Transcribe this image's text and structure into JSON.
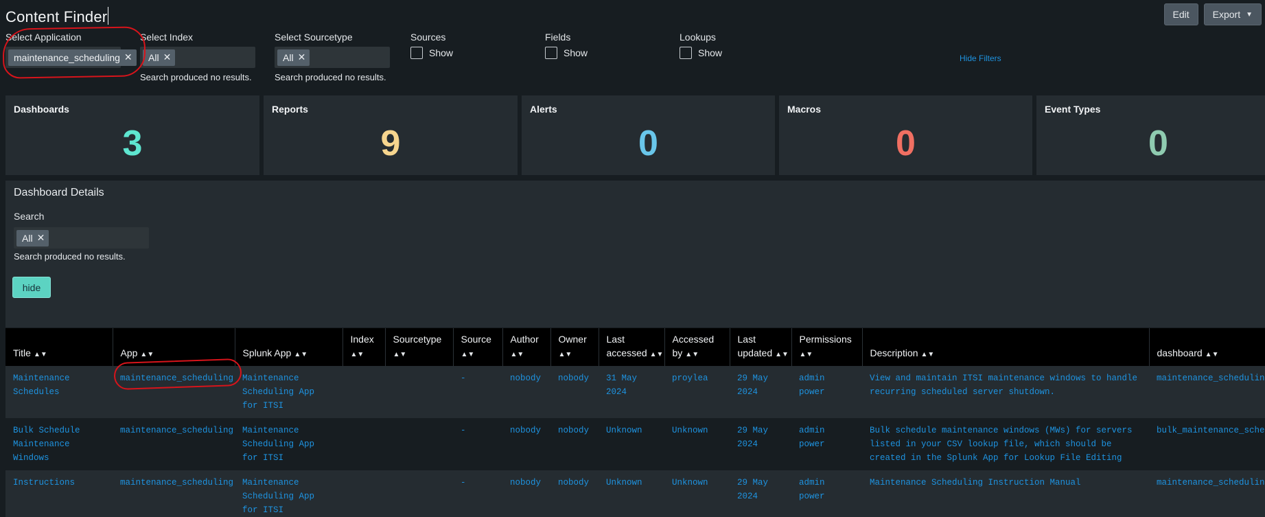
{
  "header": {
    "title": "Content Finder",
    "edit_label": "Edit",
    "export_label": "Export"
  },
  "filters": {
    "application": {
      "label": "Select Application",
      "value": "maintenance_scheduling"
    },
    "index": {
      "label": "Select Index",
      "value": "All",
      "message": "Search produced no results."
    },
    "sourcetype": {
      "label": "Select Sourcetype",
      "value": "All",
      "message": "Search produced no results."
    },
    "sources": {
      "label": "Sources",
      "option": "Show"
    },
    "fields": {
      "label": "Fields",
      "option": "Show"
    },
    "lookups": {
      "label": "Lookups",
      "option": "Show"
    },
    "hide_filters_label": "Hide Filters"
  },
  "cards": [
    {
      "title": "Dashboards",
      "value": "3",
      "color": "#5ee6d0"
    },
    {
      "title": "Reports",
      "value": "9",
      "color": "#f6d58e"
    },
    {
      "title": "Alerts",
      "value": "0",
      "color": "#69c6ea"
    },
    {
      "title": "Macros",
      "value": "0",
      "color": "#f06f62"
    },
    {
      "title": "Event Types",
      "value": "0",
      "color": "#8fcbb0"
    }
  ],
  "dashboard_details": {
    "title": "Dashboard Details",
    "search_label": "Search",
    "search_value": "All",
    "message": "Search produced no results.",
    "hide_label": "hide"
  },
  "table": {
    "columns": [
      {
        "line1": "",
        "line2": "Title"
      },
      {
        "line1": "",
        "line2": "App"
      },
      {
        "line1": "",
        "line2": "Splunk App"
      },
      {
        "line1": "Index",
        "line2": ""
      },
      {
        "line1": "Sourcetype",
        "line2": ""
      },
      {
        "line1": "Source",
        "line2": ""
      },
      {
        "line1": "Author",
        "line2": ""
      },
      {
        "line1": "Owner",
        "line2": ""
      },
      {
        "line1": "Last",
        "line2": "accessed"
      },
      {
        "line1": "Accessed",
        "line2": "by"
      },
      {
        "line1": "Last",
        "line2": "updated"
      },
      {
        "line1": "Permissions",
        "line2": ""
      },
      {
        "line1": "",
        "line2": "Description"
      },
      {
        "line1": "",
        "line2": "dashboard"
      }
    ],
    "rows": [
      {
        "title": "Maintenance Schedules",
        "app": "maintenance_scheduling",
        "splunk_app": "Maintenance Scheduling App for ITSI",
        "index": "",
        "sourcetype": "",
        "source": "-",
        "author": "nobody",
        "owner": "nobody",
        "last_accessed": "31 May 2024",
        "accessed_by": "proylea",
        "last_updated": "29 May 2024",
        "permissions": "admin power",
        "description": "View and maintain ITSI maintenance windows to handle recurring scheduled server shutdown.",
        "dashboard": "maintenance_scheduling"
      },
      {
        "title": "Bulk Schedule Maintenance Windows",
        "app": "maintenance_scheduling",
        "splunk_app": "Maintenance Scheduling App for ITSI",
        "index": "",
        "sourcetype": "",
        "source": "-",
        "author": "nobody",
        "owner": "nobody",
        "last_accessed": "Unknown",
        "accessed_by": "Unknown",
        "last_updated": "29 May 2024",
        "permissions": "admin power",
        "description": "Bulk schedule maintenance windows (MWs) for servers listed in your CSV lookup file, which should be created in the Splunk App for Lookup File Editing",
        "dashboard": "bulk_maintenance_scheduling"
      },
      {
        "title": "Instructions",
        "app": "maintenance_scheduling",
        "splunk_app": "Maintenance Scheduling App for ITSI",
        "index": "",
        "sourcetype": "",
        "source": "-",
        "author": "nobody",
        "owner": "nobody",
        "last_accessed": "Unknown",
        "accessed_by": "Unknown",
        "last_updated": "29 May 2024",
        "permissions": "admin power",
        "description": "Maintenance Scheduling Instruction Manual",
        "dashboard": "maintenance_scheduling_instructions"
      }
    ]
  }
}
